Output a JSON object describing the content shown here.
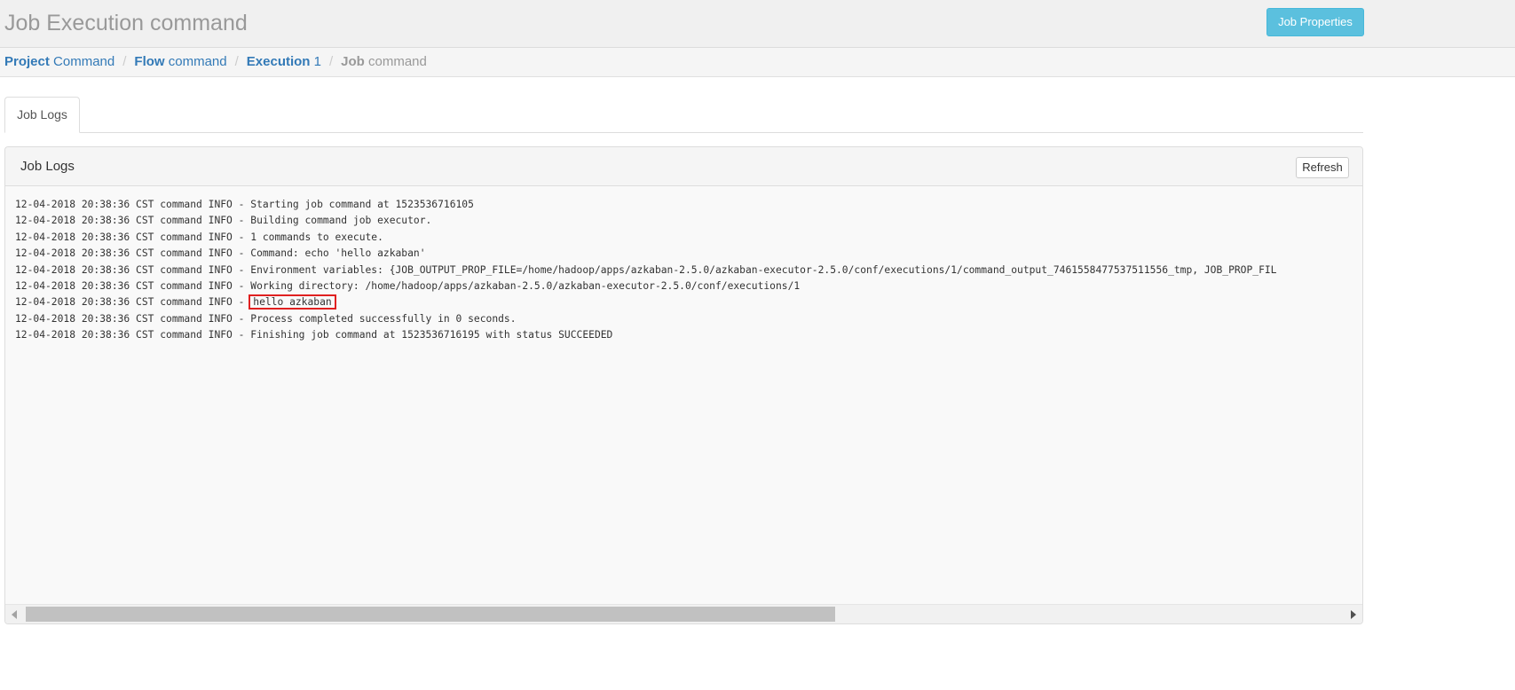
{
  "header": {
    "title": "Job Execution command",
    "job_properties_label": "Job Properties"
  },
  "breadcrumb": {
    "project_label": "Project",
    "project_value": "Command",
    "flow_label": "Flow",
    "flow_value": "command",
    "execution_label": "Execution",
    "execution_value": "1",
    "job_label": "Job",
    "job_value": "command",
    "separator": "/"
  },
  "tabs": [
    {
      "label": "Job Logs",
      "active": true
    }
  ],
  "panel": {
    "title": "Job Logs",
    "refresh_label": "Refresh"
  },
  "log": {
    "prefix": "12-04-2018 20:38:36 CST command INFO - ",
    "lines": [
      "Starting job command at 1523536716105",
      "Building command job executor.",
      "1 commands to execute.",
      "Command: echo 'hello azkaban'",
      "Environment variables: {JOB_OUTPUT_PROP_FILE=/home/hadoop/apps/azkaban-2.5.0/azkaban-executor-2.5.0/conf/executions/1/command_output_7461558477537511556_tmp, JOB_PROP_FIL",
      "Working directory: /home/hadoop/apps/azkaban-2.5.0/azkaban-executor-2.5.0/conf/executions/1",
      "hello azkaban",
      "Process completed successfully in 0 seconds.",
      "Finishing job command at 1523536716195 with status SUCCEEDED"
    ],
    "highlighted_line_index": 6
  },
  "scrollbar": {
    "horizontal_position": 0,
    "visible_fraction": 0.6
  },
  "colors": {
    "accent_button": "#5bc0de",
    "link": "#337ab7",
    "highlight_box": "#e02020"
  }
}
